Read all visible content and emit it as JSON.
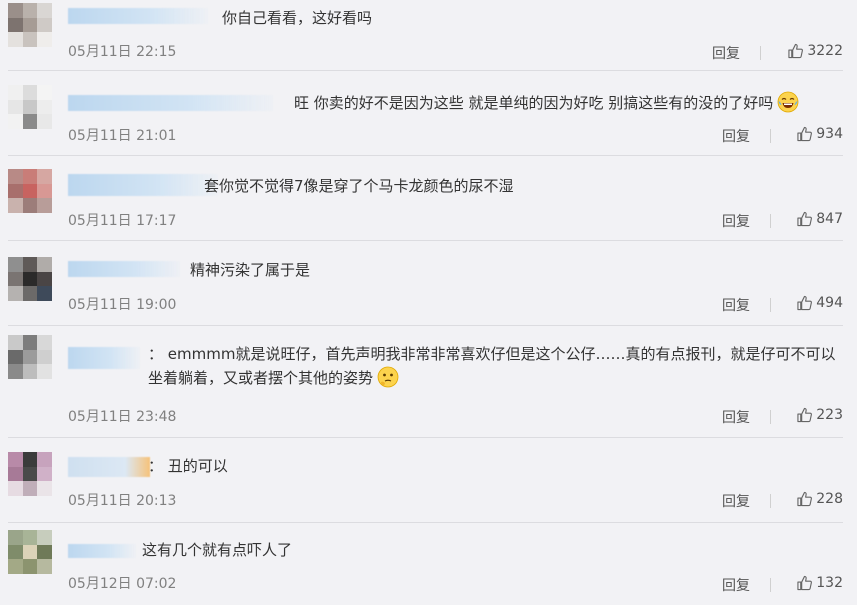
{
  "comments": [
    {
      "text": "你自己看看，这好看吗",
      "time": "05月11日 22:15",
      "reply": "回复",
      "likes": "3222"
    },
    {
      "text": "旺 你卖的好不是因为这些 就是单纯的因为好吃 别搞这些有的没的了好吗",
      "emoji": "laughing-tears-emoji",
      "time": "05月11日 21:01",
      "reply": "回复",
      "likes": "934"
    },
    {
      "text": "套你觉不觉得7像是穿了个马卡龙颜色的尿不湿",
      "time": "05月11日 17:17",
      "reply": "回复",
      "likes": "847"
    },
    {
      "text": "精神污染了属于是",
      "time": "05月11日 19:00",
      "reply": "回复",
      "likes": "494"
    },
    {
      "text": "： emmmm就是说旺仔，首先声明我非常非常喜欢仔但是这个公仔……真的有点报刊，就是仔可不可以坐着躺着，又或者摆个其他的姿势",
      "emoji": "thinking-emoji",
      "time": "05月11日 23:48",
      "reply": "回复",
      "likes": "223"
    },
    {
      "text": "： 丑的可以",
      "time": "05月11日 20:13",
      "reply": "回复",
      "likes": "228"
    },
    {
      "text": "这有几个就有点吓人了",
      "time": "05月12日 07:02",
      "reply": "回复",
      "likes": "132"
    }
  ],
  "colors": {
    "background": "#f2f2f5",
    "text": "#333333",
    "meta": "#808080",
    "name_blur": "#bcd7ef"
  }
}
